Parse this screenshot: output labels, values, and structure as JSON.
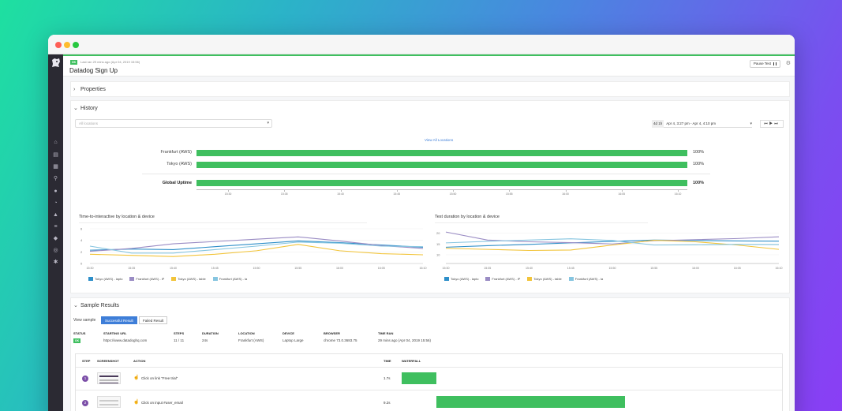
{
  "header": {
    "status": "OK",
    "last_ran": "Last ran 29 mins ago (Apr 04, 2019 15:56)",
    "title": "Datadog Sign Up",
    "pause_label": "Pause Test"
  },
  "sections": {
    "properties": "Properties",
    "history": "History",
    "sample_results": "Sample Results"
  },
  "history": {
    "location_placeholder": "All locations",
    "time_tag": "4d 1h",
    "time_range": "Apr 4, 3:27 pm - Apr 4, 4:10 pm",
    "view_all": "View All Locations",
    "uptime": [
      {
        "label": "Frankfurt (AWS)",
        "value": "100%"
      },
      {
        "label": "Tokyo (AWS)",
        "value": "100%"
      }
    ],
    "global": {
      "label": "Global Uptime",
      "value": "100%"
    },
    "ticks": [
      "15:30",
      "15:35",
      "15:40",
      "15:45",
      "15:50",
      "15:55",
      "16:00",
      "16:05",
      "16:10"
    ]
  },
  "chart_data": [
    {
      "type": "line",
      "title": "Time-to-interactive by location & device",
      "y_ticks": [
        "6",
        "4",
        "2",
        "0"
      ],
      "x": [
        "15:30",
        "15:35",
        "15:40",
        "15:45",
        "15:50",
        "15:55",
        "16:00",
        "16:05",
        "16:10"
      ],
      "ylim": [
        0,
        6
      ],
      "series": [
        {
          "name": "Tokyo (AWS) - lapto",
          "color": "#2e8fc9",
          "values": [
            2.3,
            2.5,
            2.4,
            2.9,
            3.4,
            3.9,
            3.6,
            3.2,
            2.8
          ]
        },
        {
          "name": "Frankfurt (AWS) - iP",
          "color": "#9a8cc4",
          "values": [
            2.1,
            2.6,
            3.4,
            3.8,
            4.2,
            4.6,
            3.9,
            3.1,
            2.6
          ]
        },
        {
          "name": "Tokyo (AWS) - table",
          "color": "#f2c43a",
          "values": [
            1.6,
            1.4,
            1.2,
            1.6,
            2.2,
            3.3,
            2.2,
            1.7,
            1.5
          ]
        },
        {
          "name": "Frankfurt (AWS) - la",
          "color": "#86c5e0",
          "values": [
            3.0,
            1.8,
            1.8,
            2.4,
            3.0,
            3.7,
            3.5,
            3.0,
            2.9
          ]
        }
      ]
    },
    {
      "type": "line",
      "title": "Test duration by location & device",
      "y_ticks": [
        "20",
        "15",
        "10"
      ],
      "x": [
        "15:30",
        "15:35",
        "15:40",
        "15:45",
        "15:50",
        "15:55",
        "16:00",
        "16:05",
        "16:10"
      ],
      "ylim": [
        6,
        22
      ],
      "series": [
        {
          "name": "Tokyo (AWS) - lapto",
          "color": "#2e8fc9",
          "values": [
            13.5,
            14.2,
            14.8,
            15.5,
            16.2,
            16.8,
            16.6,
            16.4,
            16.3
          ]
        },
        {
          "name": "Frankfurt (AWS) - iP",
          "color": "#9a8cc4",
          "values": [
            20.5,
            16.8,
            16.0,
            15.6,
            15.0,
            16.5,
            17.0,
            17.5,
            18.3
          ]
        },
        {
          "name": "Tokyo (AWS) - table",
          "color": "#f2c43a",
          "values": [
            13.0,
            12.5,
            12.0,
            12.2,
            14.5,
            16.7,
            16.0,
            14.5,
            12.5
          ]
        },
        {
          "name": "Frankfurt (AWS) - la",
          "color": "#86c5e0",
          "values": [
            15.5,
            16.2,
            16.8,
            17.4,
            16.6,
            14.5,
            14.6,
            14.8,
            14.7
          ]
        }
      ]
    }
  ],
  "sample": {
    "view_sample": "View sample",
    "successful": "Successful Result",
    "failed": "Failed Result",
    "columns": {
      "status": "STATUS",
      "starting_url": "STARTING URL",
      "steps": "STEPS",
      "duration": "DURATION",
      "location": "LOCATION",
      "device": "DEVICE",
      "browser": "BROWSER",
      "time_ran": "TIME RAN"
    },
    "values": {
      "status": "OK",
      "starting_url": "https://www.datadoghq.com",
      "steps": "11 / 11",
      "duration": "24s",
      "location": "Frankfurt (AWS)",
      "device": "Laptop Large",
      "browser": "chrome 73.0.3683.75",
      "time_ran": "29 mins ago (Apr 04, 2019 15:56)"
    },
    "table_headers": {
      "step": "STEP",
      "screenshot": "SCREENSHOT",
      "action": "ACTION",
      "time": "TIME",
      "waterfall": "WATERFALL"
    },
    "rows": [
      {
        "step": "1",
        "action": "Click on link \"Free trial\"",
        "time": "1.7s",
        "waterfall_start": 0.0,
        "waterfall_duration": 1.7
      },
      {
        "step": "2",
        "action": "Click on input #user_email",
        "time": "9.2s",
        "waterfall_start": 1.7,
        "waterfall_duration": 9.2
      }
    ]
  }
}
